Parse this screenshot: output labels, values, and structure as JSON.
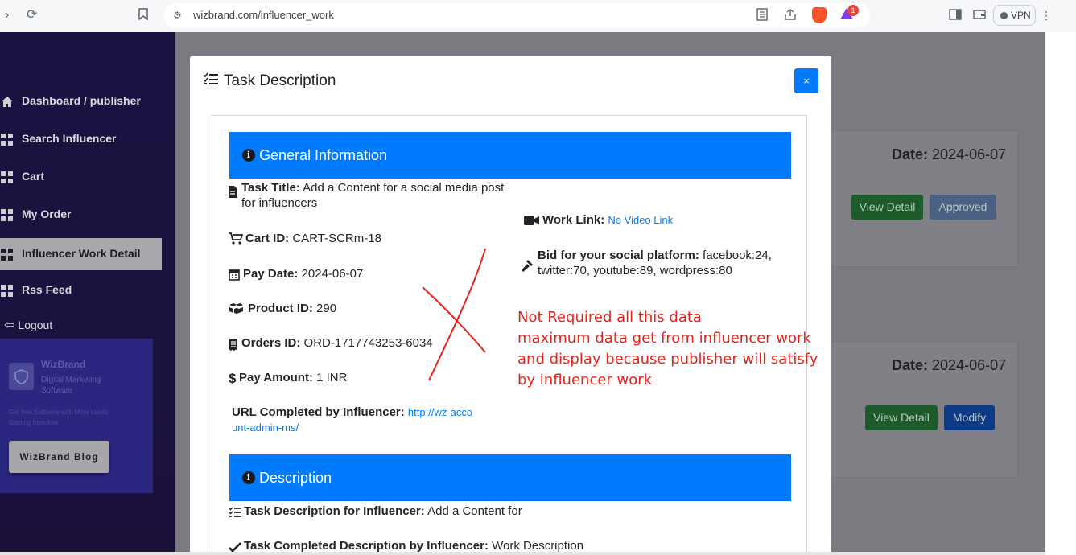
{
  "browser": {
    "url": "wizbrand.com/influencer_work",
    "vpn_label": "VPN",
    "notification_count": "1"
  },
  "sidebar": {
    "items": [
      {
        "label": "Dashboard / publisher",
        "icon": "home-icon"
      },
      {
        "label": "Search Influencer",
        "icon": "grid-icon"
      },
      {
        "label": "Cart",
        "icon": "grid-icon"
      },
      {
        "label": "My Order",
        "icon": "grid-icon"
      },
      {
        "label": "Influencer Work Detail",
        "icon": "grid-icon",
        "active": true
      },
      {
        "label": "Rss Feed",
        "icon": "grid-icon"
      }
    ],
    "logout_label": "Logout",
    "promo": {
      "brand": "WizBrand",
      "tagline": "Digital Marketing Software",
      "small_text": "Get free Software with More Leads Starting from free",
      "button_label": "WizBrand Blog"
    }
  },
  "background_cards": [
    {
      "date_label": "Date:",
      "date_value": "2024-06-07",
      "btn1": "View Detail",
      "btn2": "Approved"
    },
    {
      "date_label": "Date:",
      "date_value": "2024-06-07",
      "btn1": "View Detail",
      "btn2": "Modify"
    }
  ],
  "modal": {
    "title": "Task Description",
    "close_label": "×",
    "general": {
      "heading": "General Information",
      "task_title_label": "Task Title:",
      "task_title_value": "Add a Content for a social media post for influencers",
      "work_link_label": "Work Link:",
      "work_link_value": "No Video Link",
      "cart_id_label": "Cart ID:",
      "cart_id_value": "CART-SCRm-18",
      "bid_label": "Bid for your social platform:",
      "bid_value": "facebook:24, twitter:70, youtube:89, wordpress:80",
      "pay_date_label": "Pay Date:",
      "pay_date_value": "2024-06-07",
      "product_id_label": "Product ID:",
      "product_id_value": "290",
      "orders_id_label": "Orders ID:",
      "orders_id_value": "ORD-1717743253-6034",
      "pay_amount_label": "Pay Amount:",
      "pay_amount_value": "1 INR",
      "url_label": "URL Completed by Influencer:",
      "url_value_line1": "http://wz-acco",
      "url_value_line2": "unt-admin-ms/"
    },
    "description": {
      "heading": "Description",
      "task_desc_label": "Task Description for Influencer:",
      "task_desc_value": "Add a Content for",
      "completed_label": "Task Completed Description by Influencer:",
      "completed_value": "Work Description"
    }
  },
  "annotation": {
    "lines": [
      "Not Required all this data",
      "maximum data get from influencer work",
      "and display because publisher will satisfy",
      "by influencer work"
    ],
    "color": "#e8231a"
  }
}
